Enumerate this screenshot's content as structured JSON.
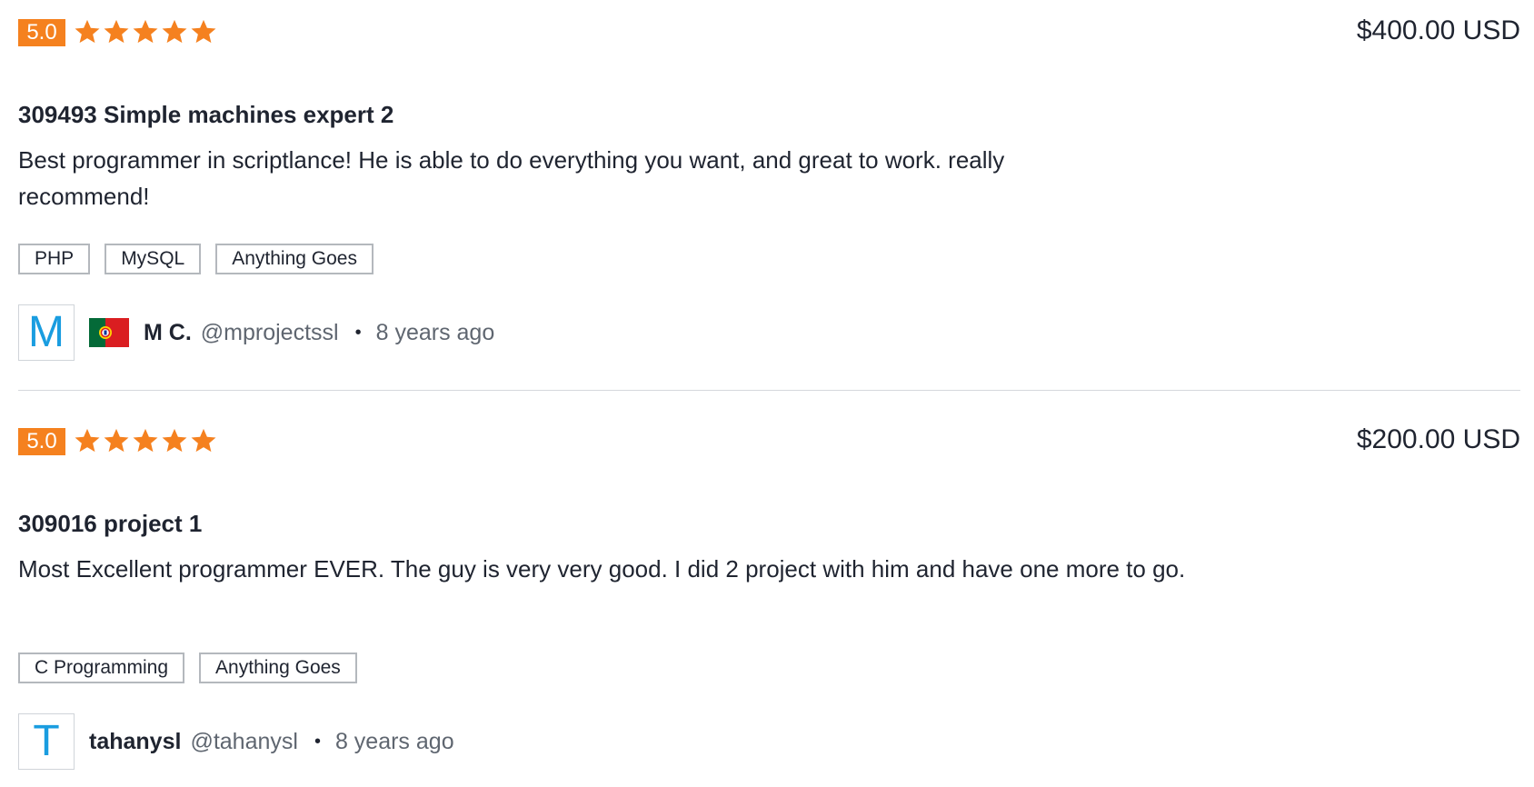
{
  "reviews": [
    {
      "rating": "5.0",
      "stars": 5,
      "price": "$400.00 USD",
      "title": "309493 Simple machines expert 2",
      "comment": "Best programmer in scriptlance! He is able to do everything you want, and great to work. really recommend!",
      "tags": [
        "PHP",
        "MySQL",
        "Anything Goes"
      ],
      "user": {
        "avatar_letter": "M",
        "flag": "portugal-flag-icon",
        "name": "M C.",
        "handle": "@mprojectssl",
        "separator": "•",
        "time": "8 years ago"
      }
    },
    {
      "rating": "5.0",
      "stars": 5,
      "price": "$200.00 USD",
      "title": "309016 project 1",
      "comment": "Most Excellent programmer EVER. The guy is very very good. I did 2 project with him and have one more to go.",
      "tags": [
        "C Programming",
        "Anything Goes"
      ],
      "user": {
        "avatar_letter": "T",
        "name": "tahanysl",
        "handle": "@tahanysl",
        "separator": "•",
        "time": "8 years ago"
      }
    }
  ],
  "colors": {
    "rating_badge": "#f5811f",
    "star": "#f5811f",
    "avatar_letter": "#1a9de0",
    "text": "#1f2430",
    "muted": "#5f6670"
  }
}
